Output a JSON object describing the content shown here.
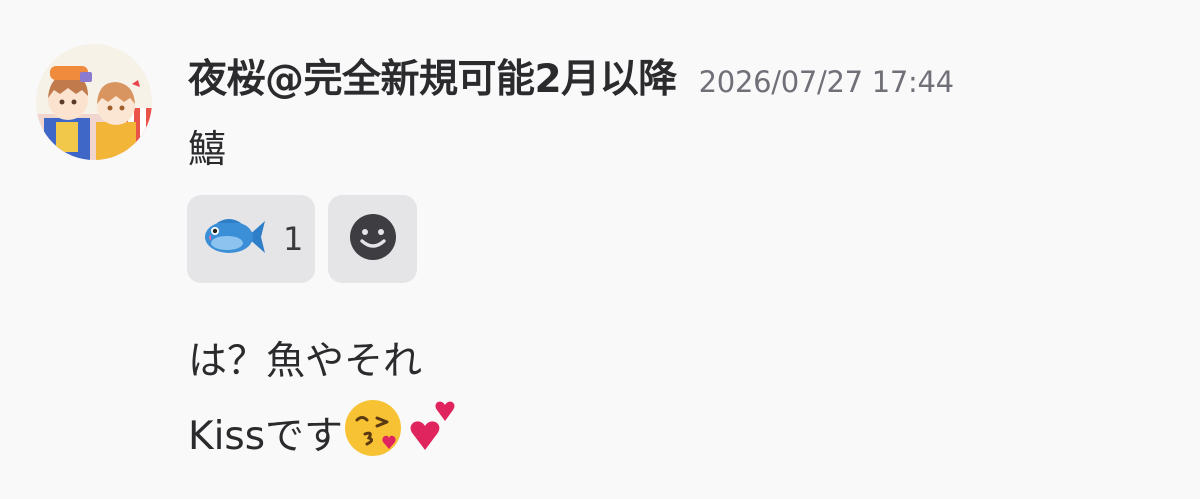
{
  "message": {
    "author": {
      "name": "夜桜@完全新規可能2月以降",
      "avatar_icon": "user-avatar-icon"
    },
    "timestamp": "2026/07/27 17:44",
    "text": "鱚",
    "reactions": [
      {
        "emoji": "🐟",
        "icon": "fish-emoji-icon",
        "count": "1"
      }
    ],
    "add_reaction_icon": "smiley-icon"
  },
  "followups": [
    {
      "text": "は？魚やそれ"
    },
    {
      "text": "Kissです",
      "emojis": [
        "face-blowing-kiss-icon",
        "two-hearts-icon"
      ]
    }
  ],
  "colors": {
    "background": "#f9f9fa",
    "chip": "#e5e5e8",
    "timestamp": "#707078",
    "smiley": "#3d3d42",
    "fish": "#3b8fd6"
  }
}
